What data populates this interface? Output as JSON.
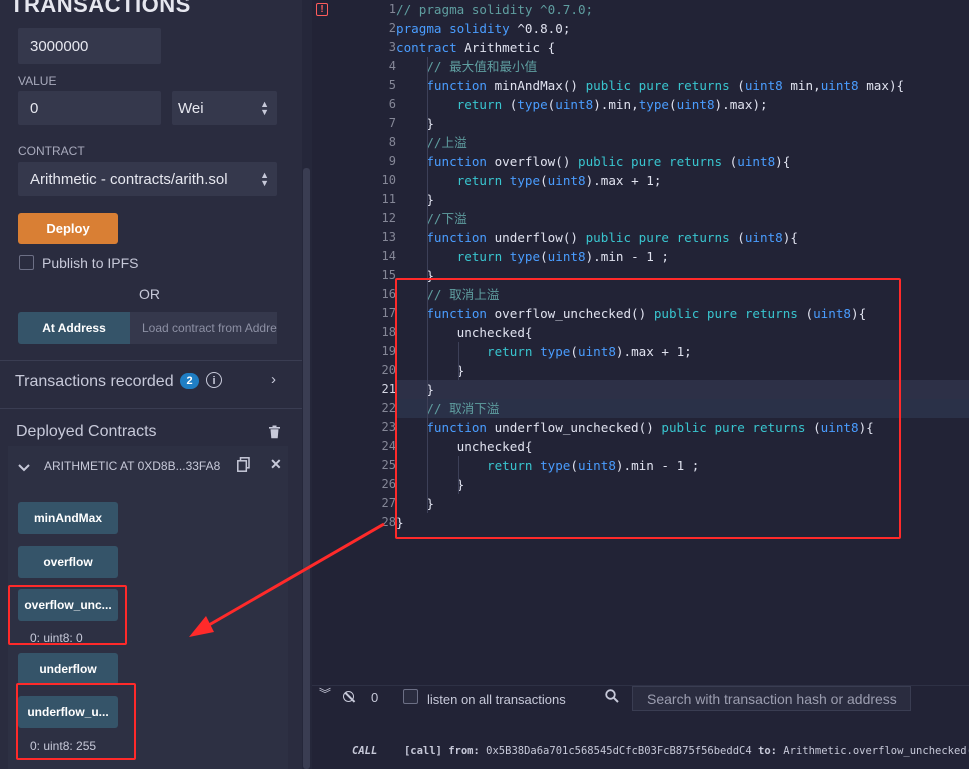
{
  "left": {
    "transactions_title": "TRANSACTIONS",
    "gas_limit_value": "3000000",
    "value_label": "VALUE",
    "value_amount": "0",
    "value_unit": "Wei",
    "contract_label": "CONTRACT",
    "contract_selected": "Arithmetic - contracts/arith.sol",
    "deploy_label": "Deploy",
    "publish_label": "Publish to IPFS",
    "or_label": "OR",
    "at_address_label": "At Address",
    "load_contract_placeholder": "Load contract from Address",
    "transactions_recorded_label": "Transactions recorded",
    "transactions_recorded_count": "2",
    "deployed_contracts_label": "Deployed Contracts",
    "instance_label": "ARITHMETIC AT 0XD8B...33FA8",
    "functions": [
      {
        "label": "minAndMax"
      },
      {
        "label": "overflow"
      },
      {
        "label": "overflow_unc...",
        "result": "0: uint8: 0"
      },
      {
        "label": "underflow"
      },
      {
        "label": "underflow_u...",
        "result": "0: uint8: 255"
      }
    ]
  },
  "editor": {
    "line_numbers": [
      "1",
      "2",
      "3",
      "4",
      "5",
      "6",
      "7",
      "8",
      "9",
      "10",
      "11",
      "12",
      "13",
      "14",
      "15",
      "16",
      "17",
      "18",
      "19",
      "20",
      "21",
      "22",
      "23",
      "24",
      "25",
      "26",
      "27",
      "28"
    ],
    "active_line": "21",
    "lines": [
      [
        {
          "t": "// pragma solidity ^0.7.0;",
          "c": "cm"
        }
      ],
      [
        {
          "t": "pragma solidity ",
          "c": "kw"
        },
        {
          "t": "^0.8.0;",
          "c": "cn"
        }
      ],
      [
        {
          "t": "contract ",
          "c": "kw"
        },
        {
          "t": "Arithmetic {",
          "c": "cn"
        }
      ],
      [
        {
          "t": "    // 最大值和最小值",
          "c": "cm"
        }
      ],
      [
        {
          "t": "    function ",
          "c": "kw"
        },
        {
          "t": "minAndMax() ",
          "c": "cn"
        },
        {
          "t": "public pure ",
          "c": "kw2"
        },
        {
          "t": "returns ",
          "c": "kw2"
        },
        {
          "t": "(",
          "c": "cn"
        },
        {
          "t": "uint8",
          "c": "kw"
        },
        {
          "t": " min,",
          "c": "cn"
        },
        {
          "t": "uint8",
          "c": "kw"
        },
        {
          "t": " max){",
          "c": "cn"
        }
      ],
      [
        {
          "t": "        return ",
          "c": "kw2"
        },
        {
          "t": "(",
          "c": "cn"
        },
        {
          "t": "type",
          "c": "kw"
        },
        {
          "t": "(",
          "c": "cn"
        },
        {
          "t": "uint8",
          "c": "kw"
        },
        {
          "t": ").min,",
          "c": "cn"
        },
        {
          "t": "type",
          "c": "kw"
        },
        {
          "t": "(",
          "c": "cn"
        },
        {
          "t": "uint8",
          "c": "kw"
        },
        {
          "t": ").max);",
          "c": "cn"
        }
      ],
      [
        {
          "t": "    }",
          "c": "cn"
        }
      ],
      [
        {
          "t": "    //上溢",
          "c": "cm"
        }
      ],
      [
        {
          "t": "    function ",
          "c": "kw"
        },
        {
          "t": "overflow() ",
          "c": "cn"
        },
        {
          "t": "public pure ",
          "c": "kw2"
        },
        {
          "t": "returns ",
          "c": "kw2"
        },
        {
          "t": "(",
          "c": "cn"
        },
        {
          "t": "uint8",
          "c": "kw"
        },
        {
          "t": "){",
          "c": "cn"
        }
      ],
      [
        {
          "t": "        return ",
          "c": "kw2"
        },
        {
          "t": "type",
          "c": "kw"
        },
        {
          "t": "(",
          "c": "cn"
        },
        {
          "t": "uint8",
          "c": "kw"
        },
        {
          "t": ").max + 1;",
          "c": "cn"
        }
      ],
      [
        {
          "t": "    }",
          "c": "cn"
        }
      ],
      [
        {
          "t": "    //下溢",
          "c": "cm"
        }
      ],
      [
        {
          "t": "    function ",
          "c": "kw"
        },
        {
          "t": "underflow() ",
          "c": "cn"
        },
        {
          "t": "public pure ",
          "c": "kw2"
        },
        {
          "t": "returns ",
          "c": "kw2"
        },
        {
          "t": "(",
          "c": "cn"
        },
        {
          "t": "uint8",
          "c": "kw"
        },
        {
          "t": "){",
          "c": "cn"
        }
      ],
      [
        {
          "t": "        return ",
          "c": "kw2"
        },
        {
          "t": "type",
          "c": "kw"
        },
        {
          "t": "(",
          "c": "cn"
        },
        {
          "t": "uint8",
          "c": "kw"
        },
        {
          "t": ").min - 1 ;",
          "c": "cn"
        }
      ],
      [
        {
          "t": "    }",
          "c": "cn"
        }
      ],
      [
        {
          "t": "    // 取消上溢",
          "c": "cm"
        }
      ],
      [
        {
          "t": "    function ",
          "c": "kw"
        },
        {
          "t": "overflow_unchecked() ",
          "c": "cn"
        },
        {
          "t": "public pure ",
          "c": "kw2"
        },
        {
          "t": "returns ",
          "c": "kw2"
        },
        {
          "t": "(",
          "c": "cn"
        },
        {
          "t": "uint8",
          "c": "kw"
        },
        {
          "t": "){",
          "c": "cn"
        }
      ],
      [
        {
          "t": "        unchecked{",
          "c": "cn"
        }
      ],
      [
        {
          "t": "            return ",
          "c": "kw2"
        },
        {
          "t": "type",
          "c": "kw"
        },
        {
          "t": "(",
          "c": "cn"
        },
        {
          "t": "uint8",
          "c": "kw"
        },
        {
          "t": ").max + 1;",
          "c": "cn"
        }
      ],
      [
        {
          "t": "        }",
          "c": "cn"
        }
      ],
      [
        {
          "t": "    }",
          "c": "cn"
        }
      ],
      [
        {
          "t": "    // 取消下溢",
          "c": "cm"
        }
      ],
      [
        {
          "t": "    function ",
          "c": "kw"
        },
        {
          "t": "underflow_unchecked() ",
          "c": "cn"
        },
        {
          "t": "public pure ",
          "c": "kw2"
        },
        {
          "t": "returns ",
          "c": "kw2"
        },
        {
          "t": "(",
          "c": "cn"
        },
        {
          "t": "uint8",
          "c": "kw"
        },
        {
          "t": "){",
          "c": "cn"
        }
      ],
      [
        {
          "t": "        unchecked{",
          "c": "cn"
        }
      ],
      [
        {
          "t": "            return ",
          "c": "kw2"
        },
        {
          "t": "type",
          "c": "kw"
        },
        {
          "t": "(",
          "c": "cn"
        },
        {
          "t": "uint8",
          "c": "kw"
        },
        {
          "t": ").min - 1 ;",
          "c": "cn"
        }
      ],
      [
        {
          "t": "        }",
          "c": "cn"
        }
      ],
      [
        {
          "t": "    }",
          "c": "cn"
        }
      ],
      [
        {
          "t": "}",
          "c": "cn"
        }
      ]
    ]
  },
  "terminal": {
    "pending_count": "0",
    "listen_label": "listen on all transactions",
    "search_placeholder": "Search with transaction hash or address",
    "log_call": "CALL",
    "log_tag": "[call]",
    "log_from_label": "from:",
    "log_from": "0x5B38Da6a701c568545dCfcB03FcB875f56beddC4",
    "log_to_label": "to:",
    "log_to": "Arithmetic.overflow_unchecked()"
  },
  "colors": {
    "accent_deploy": "#d97f34",
    "function_button": "#355469",
    "annotation_red": "#ff2a2a"
  }
}
